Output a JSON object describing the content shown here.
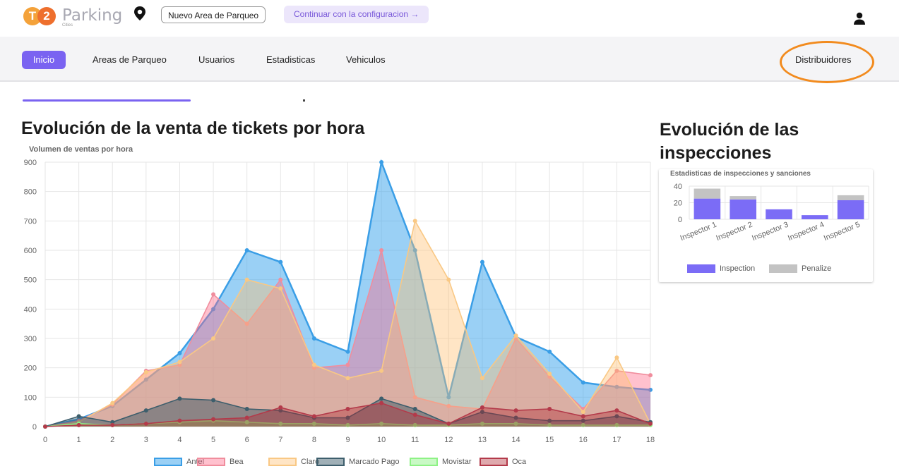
{
  "header": {
    "logo_t": "T",
    "logo_2": "2",
    "logo_word": "Parking",
    "logo_sub": "Cities",
    "new_area_label": "Nuevo Area de Parqueo",
    "continue_label": "Continuar con la configuracion   →"
  },
  "nav": {
    "home": "Inicio",
    "areas": "Areas de Parqueo",
    "users": "Usuarios",
    "stats": "Estadisticas",
    "vehicles": "Vehiculos",
    "distributors": "Distribuidores"
  },
  "colors": {
    "accent": "#7a63f1",
    "annotation": "#f28b1e"
  },
  "sales": {
    "heading": "Evolución de la venta de tickets por hora",
    "subtitle": "Volumen de ventas por hora"
  },
  "inspections": {
    "heading": "Evolución de las inspecciones",
    "subtitle": "Estadisticas de inspecciones y sanciones"
  },
  "chart_data": [
    {
      "type": "area",
      "title": "Volumen de ventas por hora",
      "x": [
        0,
        1,
        2,
        3,
        4,
        5,
        6,
        7,
        8,
        9,
        10,
        11,
        12,
        13,
        14,
        15,
        16,
        17,
        18
      ],
      "ylim": [
        0,
        900
      ],
      "yticks": [
        0,
        100,
        200,
        300,
        400,
        500,
        600,
        700,
        800,
        900
      ],
      "grid": true,
      "legend_position": "bottom",
      "series": [
        {
          "name": "Antel",
          "color": "#3a9ee6",
          "fill": "rgba(54,162,235,0.5)",
          "values": [
            0,
            25,
            70,
            160,
            250,
            400,
            600,
            560,
            300,
            255,
            900,
            600,
            100,
            560,
            305,
            255,
            150,
            135,
            125
          ]
        },
        {
          "name": "Bea",
          "color": "#f08d9d",
          "fill": "rgba(255,99,132,0.4)",
          "values": [
            0,
            20,
            75,
            190,
            210,
            450,
            350,
            500,
            200,
            210,
            600,
            100,
            70,
            60,
            300,
            170,
            60,
            190,
            175
          ]
        },
        {
          "name": "Claro",
          "color": "#f9c884",
          "fill": "rgba(255,190,110,0.4)",
          "values": [
            0,
            15,
            80,
            185,
            220,
            300,
            500,
            470,
            210,
            165,
            190,
            700,
            500,
            165,
            310,
            180,
            50,
            235,
            10
          ]
        },
        {
          "name": "Marcado Pago",
          "color": "#3d5e6c",
          "fill": "rgba(45,80,96,0.45)",
          "values": [
            0,
            35,
            15,
            55,
            95,
            90,
            60,
            55,
            30,
            30,
            95,
            60,
            10,
            50,
            30,
            20,
            20,
            35,
            15
          ]
        },
        {
          "name": "Movistar",
          "color": "#8ef285",
          "fill": "rgba(120,240,110,0.4)",
          "values": [
            0,
            10,
            5,
            10,
            15,
            20,
            15,
            10,
            10,
            5,
            10,
            5,
            5,
            10,
            10,
            5,
            5,
            5,
            5
          ]
        },
        {
          "name": "Oca",
          "color": "#b33a4a",
          "fill": "rgba(175,40,50,0.4)",
          "values": [
            0,
            5,
            5,
            10,
            20,
            25,
            30,
            65,
            35,
            60,
            80,
            40,
            10,
            65,
            55,
            60,
            35,
            55,
            10
          ]
        }
      ]
    },
    {
      "type": "bar",
      "title": "Estadisticas de inspecciones y sanciones",
      "stacked": true,
      "categories": [
        "Inspector 1",
        "Inspector 2",
        "Inspector 3",
        "Inspector 4",
        "Inspector 5"
      ],
      "ylim": [
        0,
        40
      ],
      "yticks": [
        0,
        20,
        40
      ],
      "legend_position": "bottom",
      "series": [
        {
          "name": "Inspection",
          "color": "#7b6cf6",
          "values": [
            25,
            24,
            12,
            5,
            23
          ]
        },
        {
          "name": "Penalize",
          "color": "#c3c3c3",
          "values": [
            12,
            4,
            0,
            0,
            6
          ]
        }
      ]
    }
  ]
}
